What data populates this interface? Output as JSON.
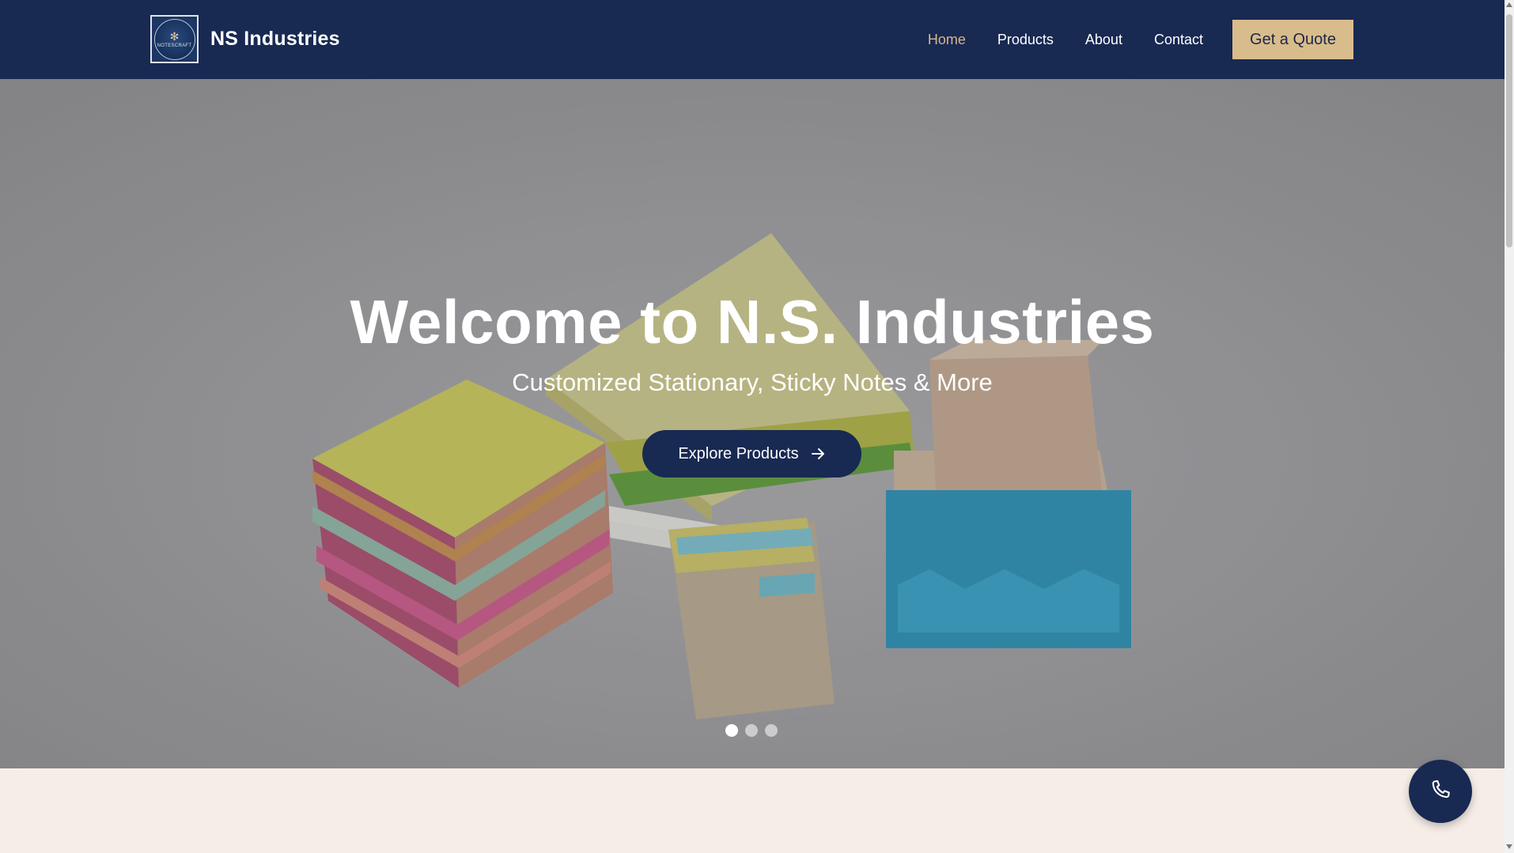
{
  "brand": {
    "name": "NS Industries",
    "logo_text": "NOTESCRAFT"
  },
  "nav": {
    "items": [
      {
        "label": "Home",
        "active": true
      },
      {
        "label": "Products",
        "active": false
      },
      {
        "label": "About",
        "active": false
      },
      {
        "label": "Contact",
        "active": false
      }
    ],
    "cta_label": "Get a Quote"
  },
  "hero": {
    "title": "Welcome to N.S. Industries",
    "subtitle": "Customized Stationary, Sticky Notes & More",
    "button_label": "Explore Products",
    "slides": 3,
    "active_slide": 1
  },
  "colors": {
    "navbar": "#182952",
    "accent": "#d9bc8c",
    "active_link": "#d6b58b",
    "section_bg": "#f6ede6"
  },
  "icons": {
    "cta_arrow": "arrow-right-icon",
    "floating": "phone-icon"
  }
}
